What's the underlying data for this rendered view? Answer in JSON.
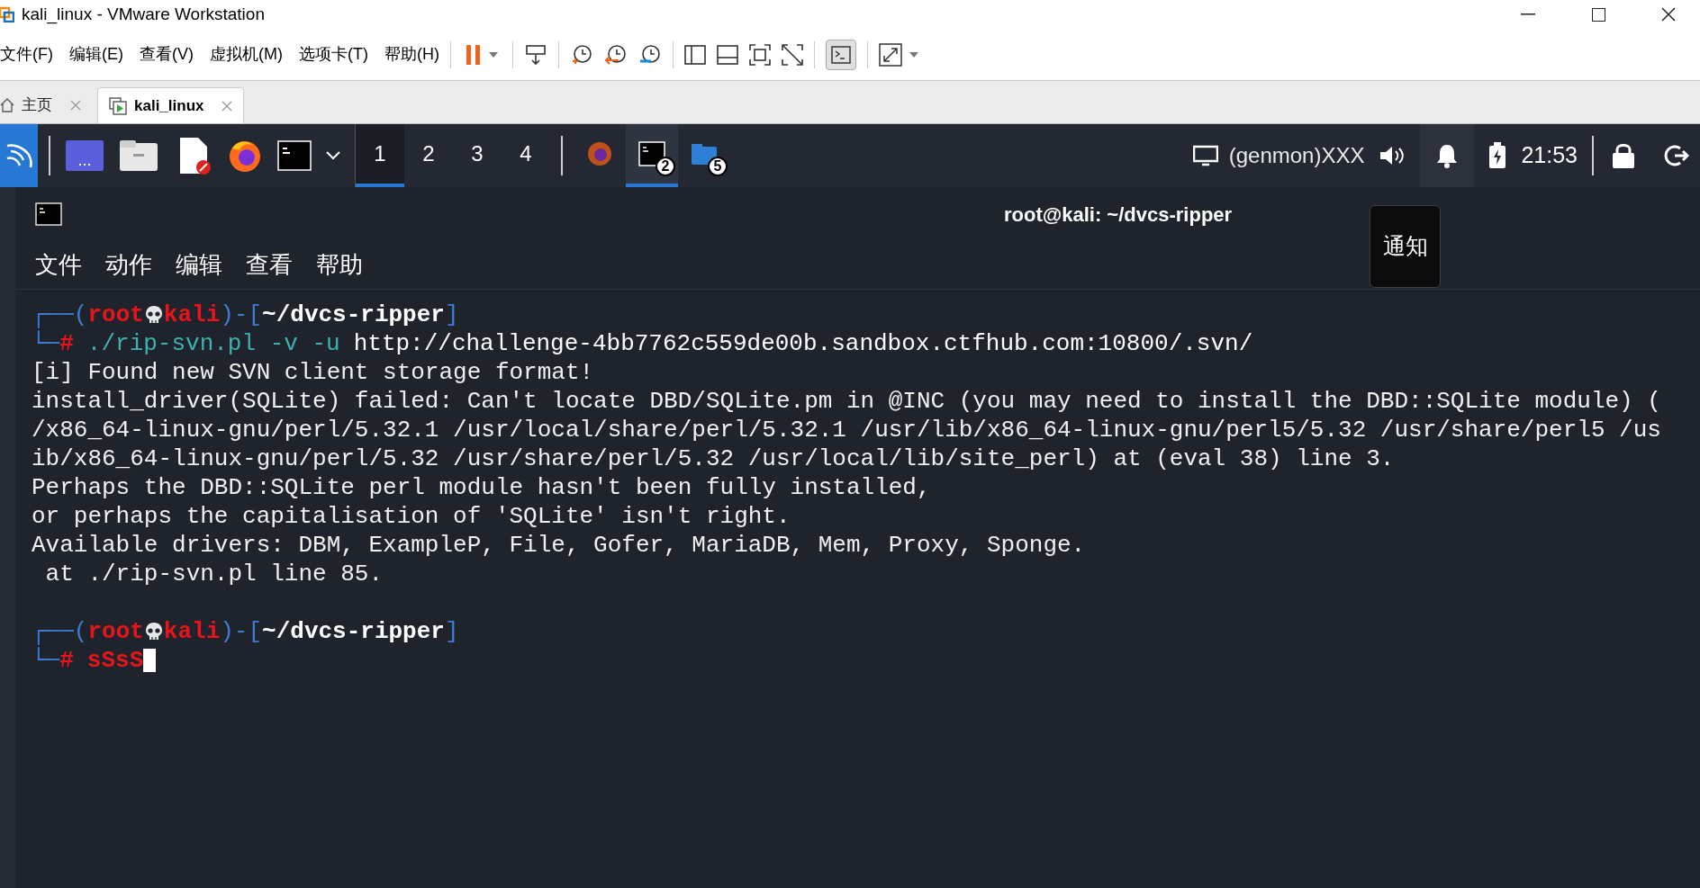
{
  "window": {
    "title": "kali_linux - VMware Workstation"
  },
  "menu": [
    "文件(F)",
    "编辑(E)",
    "查看(V)",
    "虚拟机(M)",
    "选项卡(T)",
    "帮助(H)"
  ],
  "tabs": [
    {
      "label": "主页",
      "selected": false
    },
    {
      "label": "kali_linux",
      "selected": true
    }
  ],
  "panel": {
    "workspaces": [
      {
        "label": "1",
        "selected": true
      },
      {
        "label": "2",
        "selected": false
      },
      {
        "label": "3",
        "selected": false
      },
      {
        "label": "4",
        "selected": false
      }
    ],
    "tasks": [
      {
        "kind": "firefox",
        "selected": false
      },
      {
        "kind": "terminal",
        "badge": "2",
        "selected": true
      },
      {
        "kind": "folder",
        "badge": "5",
        "selected": false
      }
    ],
    "genmon": "(genmon)XXX",
    "clock": "21:53"
  },
  "terminal": {
    "title": "root@kali: ~/dvcs-ripper",
    "menu": [
      "文件",
      "动作",
      "编辑",
      "查看",
      "帮助"
    ],
    "lines": [
      {
        "kind": "prompt",
        "frame_top": "┌──(",
        "user": "root",
        "host": "kali",
        "mid": ")-[",
        "path": "~/dvcs-ripper",
        "close": "]",
        "frame_bottom": "└─",
        "symbol": "#",
        "command": "./rip-svn.pl -v -u",
        "argument": "http://challenge-4bb7762c559de00b.sandbox.ctfhub.com:10800/.svn/",
        "valid": true
      },
      {
        "kind": "output",
        "text": "[i] Found new SVN client storage format!"
      },
      {
        "kind": "output",
        "text": "install_driver(SQLite) failed: Can't locate DBD/SQLite.pm in @INC (you may need to install the DBD::SQLite module) ("
      },
      {
        "kind": "output",
        "text": "/x86_64-linux-gnu/perl/5.32.1 /usr/local/share/perl/5.32.1 /usr/lib/x86_64-linux-gnu/perl5/5.32 /usr/share/perl5 /us"
      },
      {
        "kind": "output",
        "text": "ib/x86_64-linux-gnu/perl/5.32 /usr/share/perl/5.32 /usr/local/lib/site_perl) at (eval 38) line 3."
      },
      {
        "kind": "output",
        "text": "Perhaps the DBD::SQLite perl module hasn't been fully installed,"
      },
      {
        "kind": "output",
        "text": "or perhaps the capitalisation of 'SQLite' isn't right."
      },
      {
        "kind": "output",
        "text": "Available drivers: DBM, ExampleP, File, Gofer, MariaDB, Mem, Proxy, Sponge."
      },
      {
        "kind": "output",
        "text": " at ./rip-svn.pl line 85."
      },
      {
        "kind": "blank"
      },
      {
        "kind": "prompt",
        "frame_top": "┌──(",
        "user": "root",
        "host": "kali",
        "mid": ")-[",
        "path": "~/dvcs-ripper",
        "close": "]",
        "frame_bottom": "└─",
        "symbol": "#",
        "command": "sSsS",
        "valid": false,
        "cursor": true
      }
    ]
  },
  "notification": {
    "label": "通知"
  }
}
